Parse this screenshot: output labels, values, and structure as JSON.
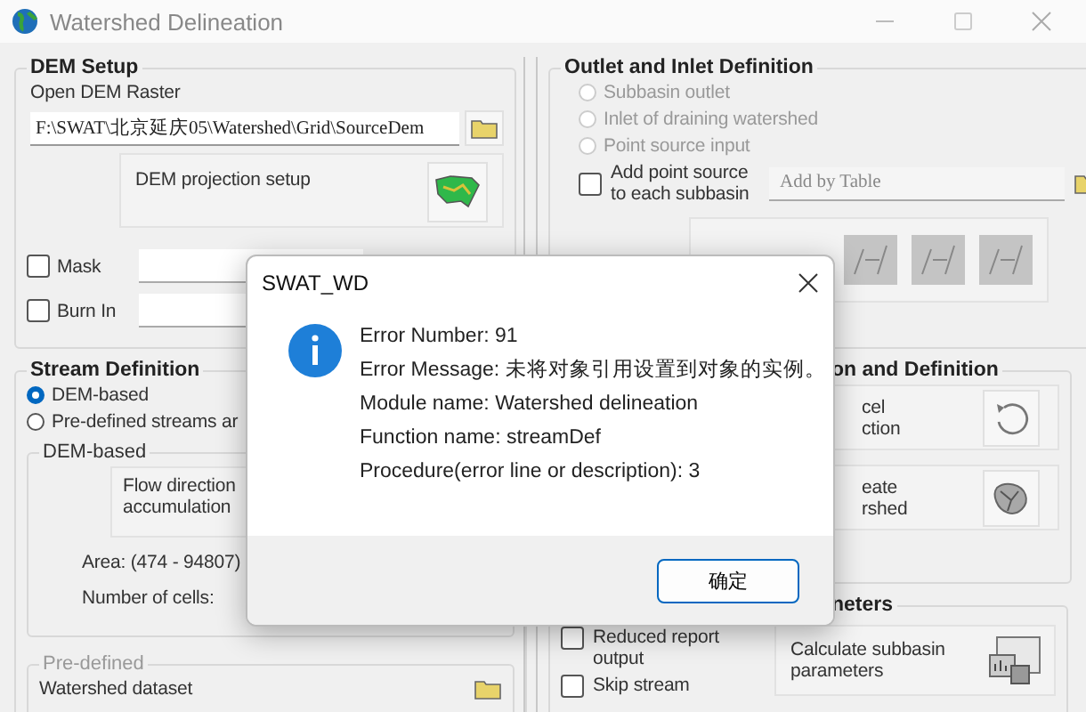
{
  "window": {
    "title": "Watershed Delineation"
  },
  "dem_setup": {
    "title": "DEM Setup",
    "raster_label": "Open DEM Raster",
    "raster_path": "F:\\SWAT\\北京延庆05\\Watershed\\Grid\\SourceDem",
    "projection_label": "DEM projection setup",
    "options": [
      {
        "label": "Mask",
        "checked": false
      },
      {
        "label": "Burn In",
        "checked": false
      }
    ]
  },
  "stream_definition": {
    "title": "Stream Definition",
    "methods": [
      {
        "label": "DEM-based",
        "selected": true
      },
      {
        "label": "Pre-defined streams ar",
        "selected": false
      }
    ],
    "dem_based": {
      "title": "DEM-based",
      "flow_label": "Flow direction\naccumulation",
      "area_label": "Area: (474 - 94807)",
      "cells_label": "Number of cells:"
    },
    "pre_defined": {
      "title": "Pre-defined",
      "dataset_label": "Watershed dataset"
    }
  },
  "outlet_inlet": {
    "title": "Outlet and Inlet Definition",
    "types": [
      {
        "label": "Subbasin outlet",
        "selected": false,
        "disabled": true
      },
      {
        "label": "Inlet of draining watershed",
        "selected": false,
        "disabled": true
      },
      {
        "label": "Point source input",
        "selected": false,
        "disabled": true
      }
    ],
    "add_point_source": {
      "label": "Add point source\nto each subbasin",
      "checked": false
    },
    "table_placeholder": "Add by Table"
  },
  "watershed_definition": {
    "title": "on and Definition",
    "actions": [
      {
        "kind": "undo",
        "label": "cel\nction"
      },
      {
        "kind": "watershed",
        "label": "eate\nrshed"
      }
    ]
  },
  "parameters": {
    "title": "neters",
    "options": [
      {
        "label": "Reduced  report\noutput",
        "checked": false
      },
      {
        "label": "Skip stream",
        "checked": false
      }
    ],
    "action_label": "Calculate subbasin\nparameters"
  },
  "dialog": {
    "title": "SWAT_WD",
    "lines": [
      "Error Number:  91",
      "Error Message:  未将对象引用设置到对象的实例。",
      "Module name:  Watershed delineation",
      "Function name:  streamDef",
      "Procedure(error line or description):  3"
    ],
    "button": "确定"
  }
}
